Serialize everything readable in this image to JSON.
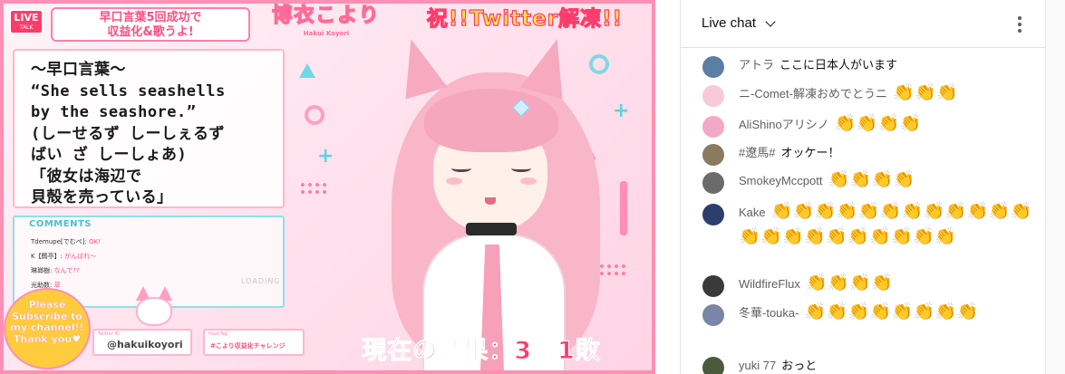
{
  "video": {
    "live_badge_top": "LIVE",
    "live_badge_bottom": "TALK",
    "topic_line1": "早口言葉5回成功で",
    "topic_line2": "収益化&歌うよ!",
    "logo_title": "博衣こより",
    "logo_romaji": "Hakui Koyori",
    "celebrate_text": "祝!!Twitter解凍!!",
    "tongue_twister": [
      "〜早口言葉〜",
      "“She sells seashells",
      "by the seashore.”",
      "(しーせるず しーしぇるず",
      "ばい ざ しーしょあ)",
      "「彼女は海辺で",
      "貝殻を売っている」"
    ],
    "comments_header": "COMMENTS",
    "comments": [
      {
        "name": "Tdemupe[でむぺ]",
        "sep": ":",
        "msg": "OK!"
      },
      {
        "name": "K【鶴亭】",
        "sep": ":",
        "msg": "がんばれ〜"
      },
      {
        "name": "琳瑯樹",
        "sep": ":",
        "msg": "なんで??"
      },
      {
        "name": "光助数",
        "sep": ":",
        "msg": "草"
      }
    ],
    "loading_text": "LOADING",
    "subscribe_lines": [
      "Please",
      "Subscribe to",
      "my channel!!",
      "Thank you♥"
    ],
    "social_caption": "Twitter ID",
    "social_value": "@hakuikoyori",
    "hashtag_caption": "HashTag",
    "hashtag_value": "#こより収益化チャレンジ",
    "result_text": "現在の結果：3勝1敗"
  },
  "chat": {
    "title": "Live chat",
    "menu_icon": "more-vert-icon",
    "chevron_icon": "chevron-down-icon",
    "messages": [
      {
        "author": "アトラ",
        "text": "ここに日本人がいます",
        "claps": 0,
        "avatar_color": "#5b7fa3"
      },
      {
        "author": "ニ-Comet-解凍おめでとうニ",
        "text": "",
        "claps": 3,
        "avatar_color": "#f7c9d9"
      },
      {
        "author": "AliShinoアリシノ",
        "text": "",
        "claps": 4,
        "avatar_color": "#f3a8c8"
      },
      {
        "author": "#遼馬#",
        "text": "オッケー！",
        "claps": 0,
        "avatar_color": "#8a7a60"
      },
      {
        "author": "SmokeyMccpott",
        "text": "",
        "claps": 4,
        "avatar_color": "#6b6b6b"
      },
      {
        "author": "Kake",
        "text": "",
        "claps": 22,
        "avatar_color": "#2c3f6a"
      },
      {
        "author": "WildfireFlux",
        "text": "",
        "claps": 4,
        "avatar_color": "#3a3a3a"
      },
      {
        "author": "冬華-touka-",
        "text": "",
        "claps": 8,
        "avatar_color": "#7a86a8"
      },
      {
        "author": "yuki 77",
        "text": "おっと",
        "claps": 0,
        "avatar_color": "#4a5a3a"
      }
    ],
    "clap_glyph": "👏"
  }
}
